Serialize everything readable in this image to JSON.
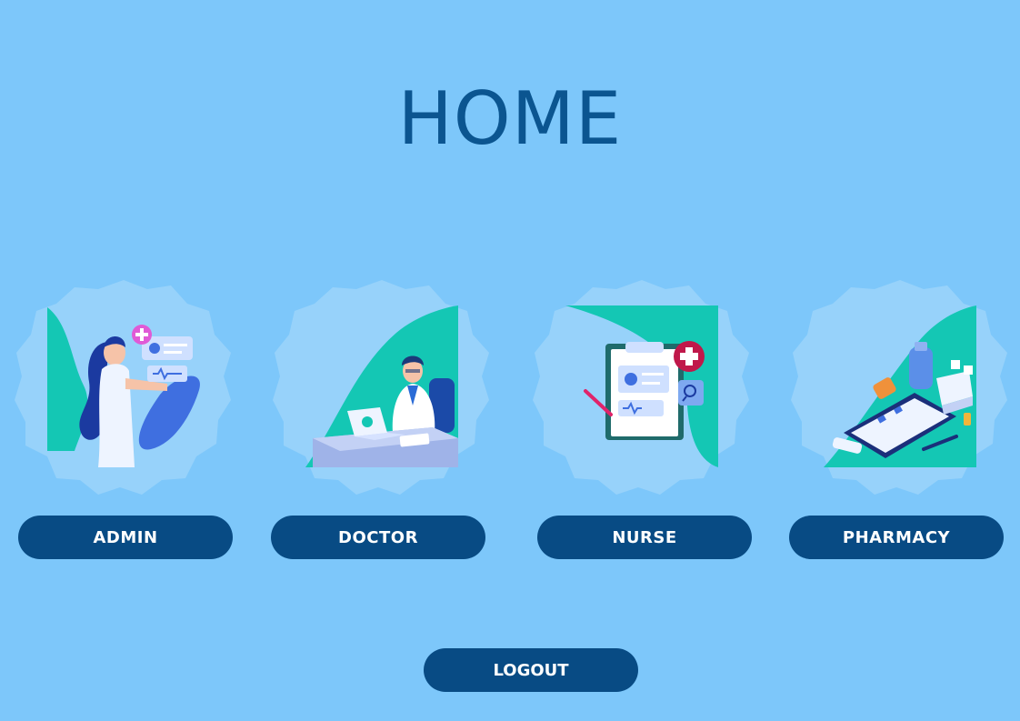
{
  "page": {
    "title": "HOME"
  },
  "roles": [
    {
      "label": "ADMIN",
      "icon": "admin-illustration-icon"
    },
    {
      "label": "DOCTOR",
      "icon": "doctor-illustration-icon"
    },
    {
      "label": "NURSE",
      "icon": "nurse-clipboard-illustration-icon"
    },
    {
      "label": "PHARMACY",
      "icon": "pharmacy-illustration-icon"
    }
  ],
  "logout": {
    "label": "LOGOUT"
  },
  "colors": {
    "background": "#7dc7fa",
    "title": "#0b5590",
    "button": "#084b84",
    "button_text": "#ffffff",
    "accent_teal": "#14c7b4"
  }
}
